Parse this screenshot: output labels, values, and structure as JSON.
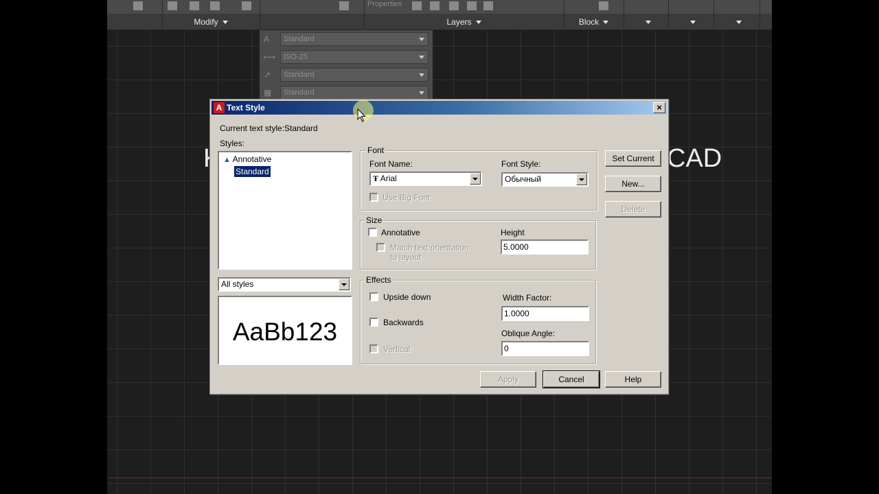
{
  "ribbon": {
    "panels": {
      "modify": "Modify",
      "layers": "Layers",
      "block": "Block"
    },
    "properties_label": "Properties"
  },
  "style_dropdowns": [
    {
      "icon": "text-style-icon",
      "value": "Standard"
    },
    {
      "icon": "dim-style-icon",
      "value": "ISO-25"
    },
    {
      "icon": "mleader-style-icon",
      "value": "Standard"
    },
    {
      "icon": "table-style-icon",
      "value": "Standard"
    }
  ],
  "background": {
    "left_text": "K",
    "right_text": "CAD"
  },
  "dialog": {
    "title": "Text Style",
    "current_style_label": "Current text style:",
    "current_style_value": "Standard",
    "styles_label": "Styles:",
    "styles": [
      {
        "name": "Annotative",
        "annotative": true,
        "selected": false
      },
      {
        "name": "Standard",
        "annotative": false,
        "selected": true
      }
    ],
    "filter_value": "All styles",
    "preview_text": "AaBb123",
    "font": {
      "group_label": "Font",
      "font_name_label": "Font Name:",
      "font_name_value": "Arial",
      "font_style_label": "Font Style:",
      "font_style_value": "Обычный",
      "use_big_font_label": "Use Big Font"
    },
    "size": {
      "group_label": "Size",
      "annotative_label": "Annotative",
      "match_label_1": "Match text orientation",
      "match_label_2": "to layout",
      "height_label": "Height",
      "height_value": "5.0000"
    },
    "effects": {
      "group_label": "Effects",
      "upside_down_label": "Upside down",
      "backwards_label": "Backwards",
      "vertical_label": "Vertical",
      "width_factor_label": "Width Factor:",
      "width_factor_value": "1.0000",
      "oblique_label": "Oblique Angle:",
      "oblique_value": "0"
    },
    "buttons": {
      "set_current": "Set Current",
      "new": "New...",
      "delete": "Delete",
      "apply": "Apply",
      "cancel": "Cancel",
      "help": "Help"
    }
  }
}
